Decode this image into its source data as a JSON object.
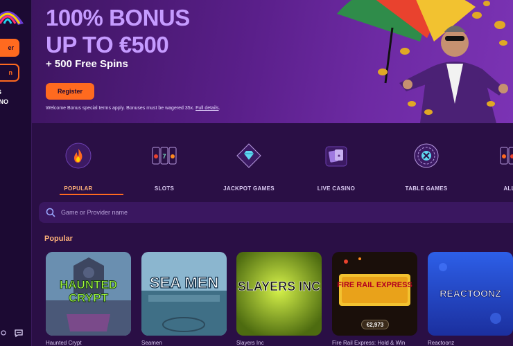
{
  "sidebar": {
    "primary_btn": "er",
    "outline_btn": "n",
    "text_line1": "ES",
    "text_line2": "SINO"
  },
  "hero": {
    "title_line1": "100% BONUS",
    "title_line2": "UP TO €500",
    "subtitle": "+ 500 Free Spins",
    "register_label": "Register",
    "terms": "Welcome Bonus special terms apply. Bonuses must be wagered 35x.",
    "terms_link": "Full details"
  },
  "categories": [
    {
      "label": "POPULAR",
      "icon": "flame-icon"
    },
    {
      "label": "SLOTS",
      "icon": "slot-machine-icon"
    },
    {
      "label": "JACKPOT GAMES",
      "icon": "diamond-icon"
    },
    {
      "label": "LIVE CASINO",
      "icon": "cards-icon"
    },
    {
      "label": "TABLE GAMES",
      "icon": "roulette-icon"
    },
    {
      "label": "ALL G",
      "icon": "slot-machine-icon"
    }
  ],
  "search": {
    "placeholder": "Game or Provider name"
  },
  "popular": {
    "title": "Popular",
    "games": [
      {
        "name": "Haunted Crypt",
        "art_title": "HAUNTED CRYPT"
      },
      {
        "name": "Seamen",
        "art_title": "SEA MEN"
      },
      {
        "name": "Slayers Inc",
        "art_title": "SLAYERS INC"
      },
      {
        "name": "Fire Rail Express: Hold & Win",
        "art_title": "FIRE RAIL EXPRESS",
        "badge": "€2,973"
      },
      {
        "name": "Reactoonz",
        "art_title": "REACTOONZ"
      }
    ]
  },
  "colors": {
    "accent": "#ff6a1f",
    "bg": "#2a0f45",
    "sidebar": "#1c0a33",
    "title": "#c59bff"
  }
}
